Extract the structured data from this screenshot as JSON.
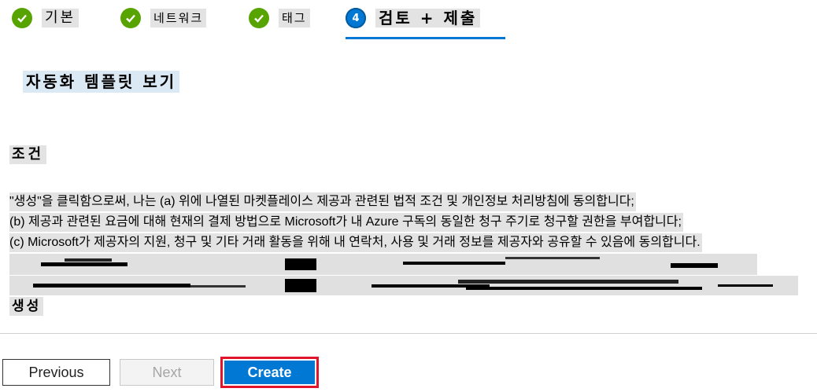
{
  "wizard": {
    "steps": [
      {
        "label": "기본",
        "status": "complete"
      },
      {
        "label": "네트워크",
        "status": "complete"
      },
      {
        "label": "태그",
        "status": "complete"
      },
      {
        "number": "4",
        "label": "검토 + 제출",
        "status": "active"
      }
    ]
  },
  "main": {
    "template_link": "자동화 템플릿 보기",
    "terms_heading": "조건",
    "terms_lines": [
      "\"생성\"을 클릭함으로써, 나는 (a) 위에 나열된 마켓플레이스 제공과 관련된 법적 조건 및 개인정보 처리방침에 동의합니다;",
      "(b) 제공과 관련된 요금에 대해 현재의 결제 방법으로 Microsoft가 내 Azure 구독의 동일한 청구 주기로 청구할 권한을 부여합니다;",
      "(c) Microsoft가 제공자의 지원, 청구 및 기타 거래 활동을 위해 내 연락처, 사용 및 거래 정보를 제공자와 공유할 수 있음에 동의합니다."
    ],
    "create_label": "생성"
  },
  "footer": {
    "previous_label": "Previous",
    "next_label": "Next",
    "create_label": "Create"
  },
  "colors": {
    "complete": "#57a300",
    "accent": "#0078d4",
    "highlight": "#e0142b"
  }
}
